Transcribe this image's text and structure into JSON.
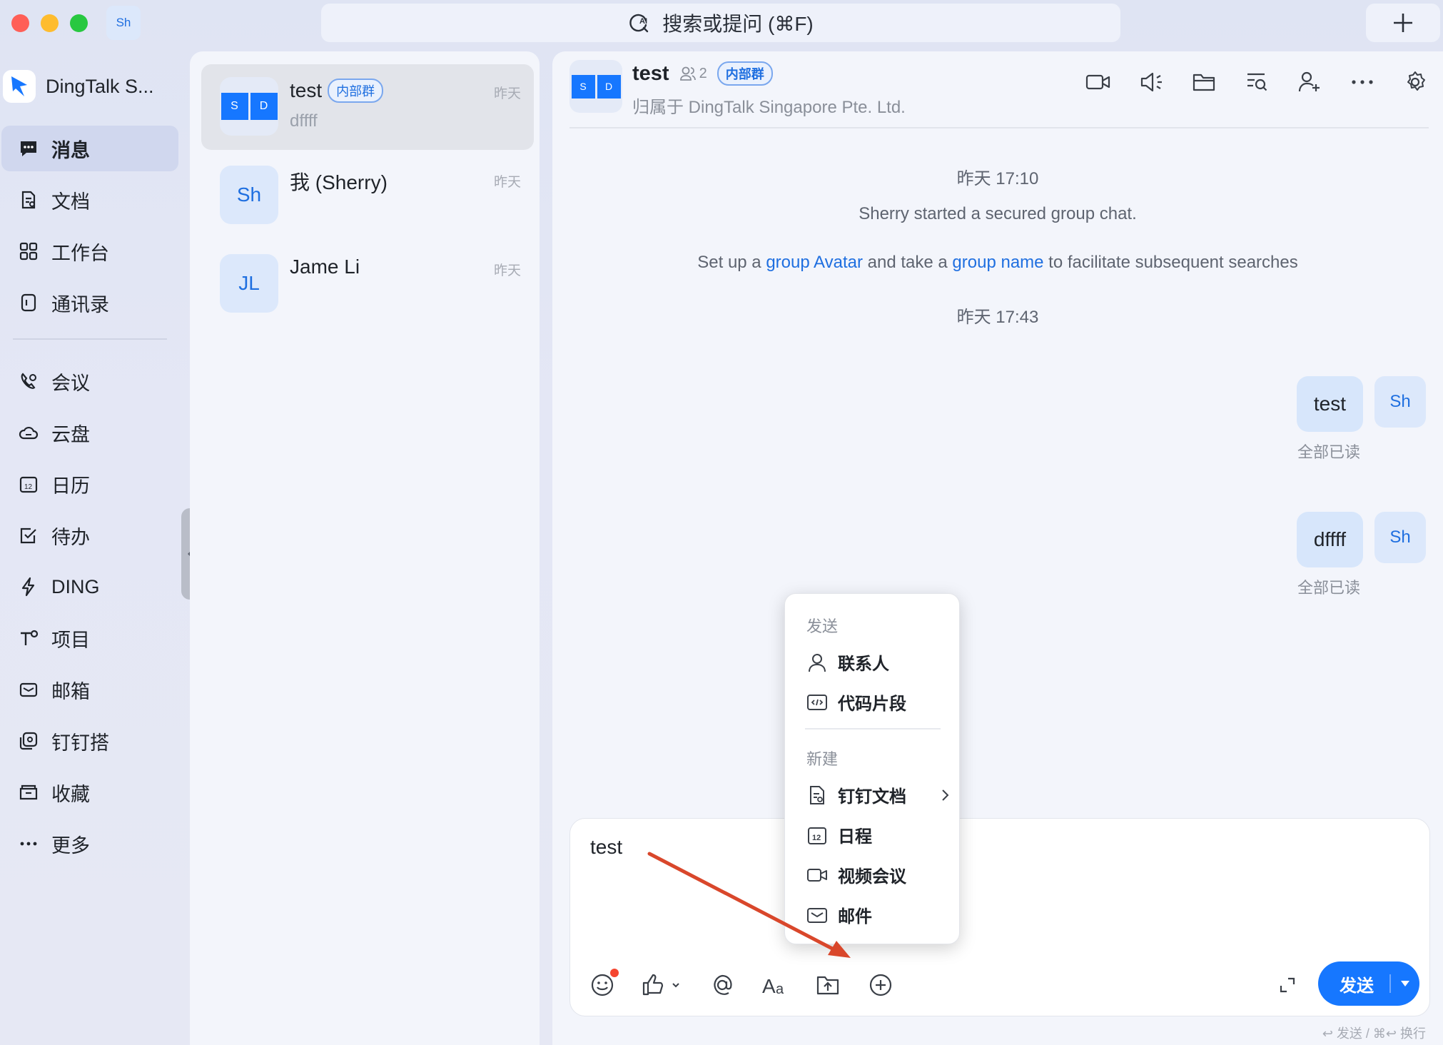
{
  "window": {
    "user_initials": "Sh"
  },
  "search": {
    "placeholder": "搜索或提问 (⌘F)"
  },
  "brand": {
    "name": "DingTalk S..."
  },
  "nav": {
    "primary": [
      {
        "label": "消息",
        "icon": "message-icon",
        "active": true
      },
      {
        "label": "文档",
        "icon": "document-icon"
      },
      {
        "label": "工作台",
        "icon": "workspace-icon"
      },
      {
        "label": "通讯录",
        "icon": "contacts-icon"
      }
    ],
    "secondary": [
      {
        "label": "会议",
        "icon": "meeting-icon"
      },
      {
        "label": "云盘",
        "icon": "cloud-icon"
      },
      {
        "label": "日历",
        "icon": "calendar-icon"
      },
      {
        "label": "待办",
        "icon": "todo-icon"
      },
      {
        "label": "DING",
        "icon": "ding-icon"
      },
      {
        "label": "项目",
        "icon": "project-icon"
      },
      {
        "label": "邮箱",
        "icon": "mail-icon"
      },
      {
        "label": "钉钉搭",
        "icon": "builder-icon"
      },
      {
        "label": "收藏",
        "icon": "favorites-icon"
      },
      {
        "label": "更多",
        "icon": "more-icon"
      }
    ]
  },
  "chats": [
    {
      "name": "test",
      "tag": "内部群",
      "preview": "dffff",
      "time": "昨天",
      "avatar": [
        "S",
        "D"
      ],
      "active": true
    },
    {
      "name": "我 (Sherry)",
      "preview": "",
      "time": "昨天",
      "avatar_text": "Sh"
    },
    {
      "name": "Jame Li",
      "preview": "",
      "time": "昨天",
      "avatar_text": "JL"
    }
  ],
  "conversation": {
    "title": "test",
    "member_count": "2",
    "tag": "内部群",
    "avatar": [
      "S",
      "D"
    ],
    "subtitle": "归属于 DingTalk Singapore Pte. Ltd.",
    "toolbar_icons": [
      "video-call-icon",
      "announcement-icon",
      "folder-icon",
      "search-history-icon",
      "add-member-icon",
      "more-icon",
      "settings-icon"
    ]
  },
  "messages": {
    "time1": "昨天 17:10",
    "sys1": "Sherry started a secured group chat.",
    "sys2_pre": "Set up a ",
    "sys2_link1": "group Avatar",
    "sys2_mid": " and take a ",
    "sys2_link2": "group name",
    "sys2_post": " to facilitate subsequent searches",
    "time2": "昨天 17:43",
    "bubbles": [
      {
        "text": "test",
        "avatar": "Sh",
        "status": "全部已读"
      },
      {
        "text": "dffff",
        "avatar": "Sh",
        "status": "全部已读"
      }
    ]
  },
  "composer": {
    "text": "test",
    "send_label": "发送",
    "hint": "↩ 发送 / ⌘↩ 换行",
    "tools": [
      "emoji-icon",
      "thumbs-up-icon",
      "mention-icon",
      "format-icon",
      "upload-folder-icon",
      "plus-circle-icon"
    ]
  },
  "menu": {
    "section1": "发送",
    "items1": [
      {
        "label": "联系人",
        "icon": "contact-card-icon"
      },
      {
        "label": "代码片段",
        "icon": "code-snippet-icon"
      }
    ],
    "section2": "新建",
    "items2": [
      {
        "label": "钉钉文档",
        "icon": "doc-new-icon",
        "submenu": true
      },
      {
        "label": "日程",
        "icon": "schedule-icon"
      },
      {
        "label": "视频会议",
        "icon": "video-meeting-icon"
      },
      {
        "label": "邮件",
        "icon": "email-icon"
      }
    ]
  },
  "colors": {
    "accent": "#1677ff",
    "link": "#1f6fe0",
    "annotation_arrow": "#d9472b"
  }
}
